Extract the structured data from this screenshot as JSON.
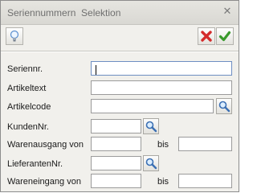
{
  "window": {
    "title": "Seriennummern  Selektion",
    "close_icon": "close-icon"
  },
  "toolbar": {
    "hint_icon": "lightbulb-icon",
    "cancel_icon": "red-x-icon",
    "ok_icon": "green-check-icon"
  },
  "form": {
    "seriennr": {
      "label": "Seriennr.",
      "value": ""
    },
    "artikeltext": {
      "label": "Artikeltext",
      "value": ""
    },
    "artikelcode": {
      "label": "Artikelcode",
      "value": ""
    },
    "kundennr": {
      "label": "KundenNr.",
      "value": ""
    },
    "warenausgang": {
      "label": "Warenausgang von",
      "from": "",
      "bis_label": "bis",
      "to": ""
    },
    "lieferantennr": {
      "label": "LieferantenNr.",
      "value": ""
    },
    "wareneingang": {
      "label": "Wareneingang von",
      "from": "",
      "bis_label": "bis",
      "to": ""
    }
  },
  "colors": {
    "window_bg": "#f1f0ec",
    "cancel_red": "#d42b2b",
    "ok_green": "#3a9a2c"
  }
}
